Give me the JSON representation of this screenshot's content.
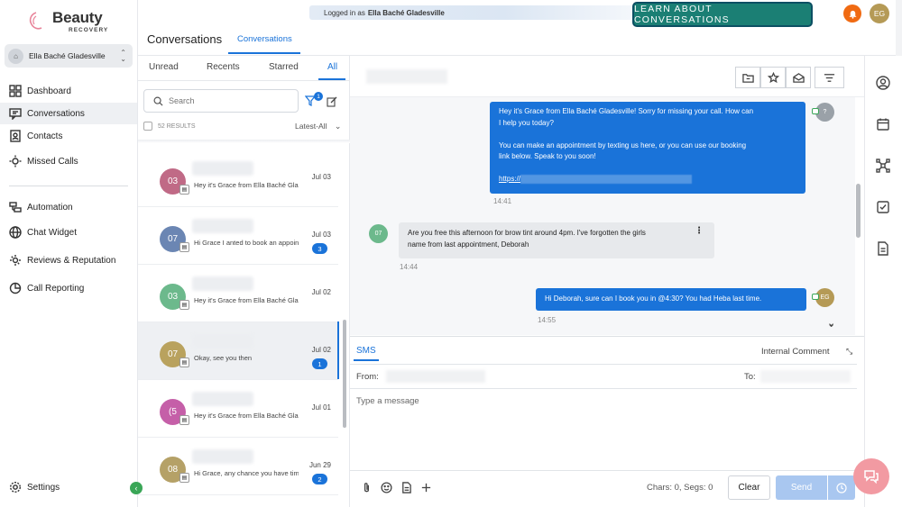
{
  "brand": {
    "name": "Beauty",
    "sub": "RECOVERY"
  },
  "location": {
    "name": "Ella Baché Gladesville"
  },
  "nav": {
    "items": [
      {
        "label": "Dashboard",
        "icon": "dashboard-icon"
      },
      {
        "label": "Conversations",
        "icon": "chat-icon"
      },
      {
        "label": "Contacts",
        "icon": "contacts-icon"
      },
      {
        "label": "Missed Calls",
        "icon": "missed-calls-icon"
      }
    ],
    "items2": [
      {
        "label": "Automation",
        "icon": "automation-icon"
      },
      {
        "label": "Chat Widget",
        "icon": "globe-icon"
      },
      {
        "label": "Reviews & Reputation",
        "icon": "reviews-icon"
      },
      {
        "label": "Call Reporting",
        "icon": "pie-chart-icon"
      }
    ],
    "settings": "Settings"
  },
  "topbar": {
    "logged_in_prefix": "Logged in as",
    "logged_in_name": "Ella Baché Gladesville",
    "learn_button": "LEARN ABOUT CONVERSATIONS",
    "user_initials": "EG",
    "page_title": "Conversations",
    "page_tab": "Conversations"
  },
  "list": {
    "tabs": [
      "Unread",
      "Recents",
      "Starred",
      "All"
    ],
    "active_tab": "All",
    "search_placeholder": "Search",
    "filter_count": "1",
    "results": "52 RESULTS",
    "sort": "Latest-All",
    "rows": [
      {
        "initials": "03",
        "color": "#c06a86",
        "preview": "Hey it's Grace from Ella Baché Gladesville",
        "date": "Jul 03",
        "badge": ""
      },
      {
        "initials": "07",
        "color": "#6b86b3",
        "preview": "Hi Grace I anted to book an appointment",
        "date": "Jul 03",
        "badge": "3"
      },
      {
        "initials": "03",
        "color": "#6cb98c",
        "preview": "Hey it's Grace from Ella Baché Gladesville",
        "date": "Jul 02",
        "badge": ""
      },
      {
        "initials": "07",
        "color": "#b9a25e",
        "preview": "Okay, see you then",
        "date": "Jul 02",
        "badge": "1"
      },
      {
        "initials": "(5",
        "color": "#c55fa8",
        "preview": "Hey it's Grace from Ella Baché Gladesville",
        "date": "Jul 01",
        "badge": ""
      },
      {
        "initials": "08",
        "color": "#b5a167",
        "preview": "Hi Grace, any chance you have time",
        "date": "Jun 29",
        "badge": "2"
      }
    ]
  },
  "chat": {
    "messages": {
      "m1_lines": [
        "Hey it's Grace from Ella Baché Gladesville! Sorry for missing your call. How can",
        "I help you today?",
        "",
        "You can make an appointment by texting us here, or you can use our booking",
        "link below. Speak to you soon!",
        "",
        "https://"
      ],
      "m1_avatar": "?",
      "m1_time": "14:41",
      "m2_lines": [
        "Are you free this afternoon for brow tint around 4pm. I've forgotten the girls",
        "name from last appointment, Deborah"
      ],
      "m2_avatar": "07",
      "m2_time": "14:44",
      "m3": "Hi Deborah, sure can I book you in @4:30? You had Heba last time.",
      "m3_avatar": "EG",
      "m3_time": "14:55"
    },
    "composer": {
      "tab_sms": "SMS",
      "tab_internal": "Internal Comment",
      "from_label": "From:",
      "to_label": "To:",
      "placeholder": "Type a message",
      "chars": "Chars: 0, Segs: 0",
      "clear": "Clear",
      "send": "Send"
    }
  },
  "colors": {
    "accent": "#1a73d9",
    "learn_btn": "#1b7f74",
    "bell": "#f06a12",
    "help_fab": "#f29aa2"
  }
}
